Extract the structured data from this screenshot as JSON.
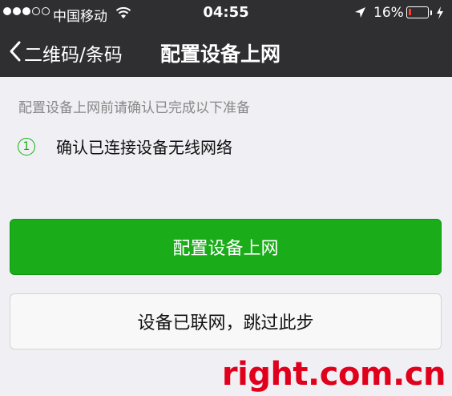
{
  "status_bar": {
    "carrier": "中国移动",
    "time": "04:55",
    "battery_percent_text": "16%",
    "battery_level": 0.16,
    "icons": [
      "signal-dots-icon",
      "wifi-icon",
      "location-arrow-icon",
      "battery-icon",
      "charging-bolt-icon"
    ]
  },
  "nav": {
    "back_label": "二维码/条码",
    "title": "配置设备上网"
  },
  "content": {
    "hint": "配置设备上网前请确认已完成以下准备",
    "checklist": [
      {
        "number": "1",
        "text": "确认已连接设备无线网络"
      }
    ]
  },
  "buttons": {
    "primary": "配置设备上网",
    "secondary": "设备已联网，跳过此步"
  },
  "watermark": "right.com.cn",
  "colors": {
    "bar_bg": "#2f2f31",
    "page_bg": "#efeff4",
    "primary_green": "#1aad19",
    "battery_low": "#ff3b30",
    "watermark_red": "#e0001c"
  }
}
